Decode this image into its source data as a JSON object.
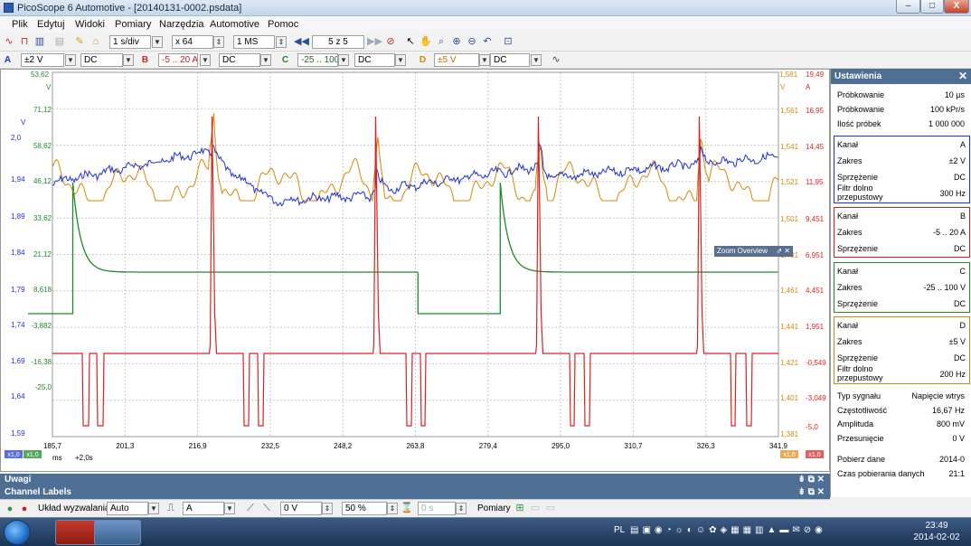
{
  "window": {
    "title": "PicoScope 6 Automotive - [20140131-0002.psdata]",
    "min": "–",
    "max": "□",
    "close": "X"
  },
  "menu": [
    "Plik",
    "Edytuj",
    "Widoki",
    "Pomiary",
    "Narzędzia",
    "Automotive",
    "Pomoc"
  ],
  "toolbar": {
    "timebase": "1 s/div",
    "zoom": "x 64",
    "samples": "1 MS",
    "buffer": "5 z 5"
  },
  "channels": [
    {
      "id": "A",
      "range": "±2 V",
      "coupling": "DC",
      "color": "#1f2fd0"
    },
    {
      "id": "B",
      "range": "-5 .. 20 A",
      "coupling": "DC",
      "color": "#e02020"
    },
    {
      "id": "C",
      "range": "-25 .. 100 V",
      "coupling": "DC",
      "color": "#1e8a2a"
    },
    {
      "id": "D",
      "range": "±5 V",
      "coupling": "DC",
      "color": "#d08a00"
    }
  ],
  "scope": {
    "axis_top": {
      "a": "53,62",
      "d": "1,581",
      "b": "19,49"
    },
    "units": {
      "a": "V",
      "c": "V",
      "d": "V",
      "b": "A"
    },
    "axis_a": [
      "2,0",
      "1,94",
      "1,89",
      "1,84",
      "1,79",
      "1,74",
      "1,69",
      "1,64",
      "1,59"
    ],
    "axis_c": [
      "71,12",
      "58,62",
      "46,12",
      "33,62",
      "21,12",
      "8,618",
      "-3,882",
      "-16,38",
      "-25,0"
    ],
    "axis_d": [
      "1,561",
      "1,541",
      "1,521",
      "1,501",
      "1,481",
      "1,461",
      "1,441",
      "1,421",
      "1,401",
      "1,381"
    ],
    "axis_b": [
      "16,95",
      "14,45",
      "11,95",
      "9,451",
      "6,951",
      "4,451",
      "1,951",
      "-0,549",
      "-3,049",
      "-5,0"
    ],
    "x_ticks": [
      "185,7",
      "201,3",
      "216,9",
      "232,5",
      "248,2",
      "263,8",
      "279,4",
      "295,0",
      "310,7",
      "326,3",
      "341,9"
    ],
    "x_unit": "ms",
    "x_extra": "+2,0s",
    "corner_labels": {
      "a": "x1,0",
      "c": "x1,0",
      "d": "x1,0",
      "b": "x1,0"
    },
    "zoom_overview": "Zoom Overview"
  },
  "panes": {
    "notes": "Uwagi",
    "channel_labels": "Channel Labels"
  },
  "trigger": {
    "mode_label": "Układ wyzwalania",
    "mode": "Auto",
    "channel": "A",
    "level": "0 V",
    "pre": "50 %",
    "delay": "0 s",
    "measure_label": "Pomiary"
  },
  "settings": {
    "title": "Ustawienia",
    "general": [
      {
        "k": "Próbkowanie",
        "v": "10 µs"
      },
      {
        "k": "Próbkowanie",
        "v": "100 kPr/s"
      },
      {
        "k": "Ilość próbek",
        "v": "1 000 000"
      }
    ],
    "channels": [
      {
        "rows": [
          {
            "k": "Kanał",
            "v": "A"
          },
          {
            "k": "Zakres",
            "v": "±2 V"
          },
          {
            "k": "Sprzężenie",
            "v": "DC"
          },
          {
            "k": "Filtr dolno przepustowy",
            "v": "300 Hz"
          }
        ]
      },
      {
        "rows": [
          {
            "k": "Kanał",
            "v": "B"
          },
          {
            "k": "Zakres",
            "v": "-5 .. 20 A"
          },
          {
            "k": "Sprzężenie",
            "v": "DC"
          }
        ]
      },
      {
        "rows": [
          {
            "k": "Kanał",
            "v": "C"
          },
          {
            "k": "Zakres",
            "v": "-25 .. 100 V"
          },
          {
            "k": "Sprzężenie",
            "v": "DC"
          }
        ]
      },
      {
        "rows": [
          {
            "k": "Kanał",
            "v": "D"
          },
          {
            "k": "Zakres",
            "v": "±5 V"
          },
          {
            "k": "Sprzężenie",
            "v": "DC"
          },
          {
            "k": "Filtr dolno przepustowy",
            "v": "200 Hz"
          }
        ]
      }
    ],
    "signal": [
      {
        "k": "Typ sygnału",
        "v": "Napięcie wtrys"
      },
      {
        "k": "Częstotliwość",
        "v": "16,67 Hz"
      },
      {
        "k": "Amplituda",
        "v": "800 mV"
      },
      {
        "k": "Przesunięcie",
        "v": "0 V"
      }
    ],
    "capture": [
      {
        "k": "Pobierz dane",
        "v": "2014-0"
      },
      {
        "k": "Czas pobierania danych",
        "v": "21:1"
      }
    ]
  },
  "taskbar": {
    "lang": "PL",
    "time": "23:49",
    "date": "2014-02-02"
  },
  "waveforms": {
    "c_high_segments": [
      [
        79.5,
        461.3
      ],
      [
        552.3,
        860
      ]
    ],
    "c_low_segments": [
      [
        30,
        79.5
      ],
      [
        461.3,
        552.3
      ]
    ],
    "b_spikes": [
      233.5,
      414.5,
      594.5,
      772.5
    ],
    "b_pulses": [
      [
        90,
        98
      ],
      [
        106,
        114
      ],
      [
        268,
        275
      ],
      [
        284,
        291
      ],
      [
        448,
        455
      ],
      [
        464,
        470
      ],
      [
        629,
        635
      ],
      [
        645,
        652
      ],
      [
        807,
        813
      ],
      [
        824,
        831
      ]
    ]
  }
}
